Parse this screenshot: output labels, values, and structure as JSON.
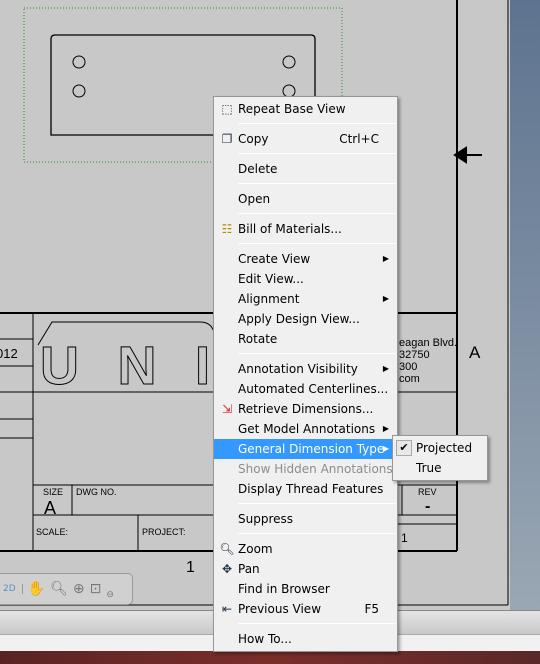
{
  "drawing": {
    "title_block": {
      "year_fragment": "012",
      "logo_text": "UNI",
      "address_lines": [
        "eagan Blvd.",
        "32750",
        "300",
        "com"
      ],
      "zone_letter": "A",
      "size_label": "SIZE",
      "size_value": "A",
      "dwg_no_label": "DWG NO.",
      "rev_label": "REV",
      "rev_value": "-",
      "scale_label": "SCALE:",
      "project_label": "PROJECT:",
      "sheet_value": "1"
    },
    "sheet_number": "1"
  },
  "nav_toolbar": {
    "mode_label": "2D",
    "tools": [
      "pan-icon",
      "zoom-icon",
      "zoom-all-icon",
      "zoom-window-icon"
    ]
  },
  "context_menu": {
    "items": [
      {
        "label": "Repeat Base View",
        "icon": "repeat-base-view-icon"
      },
      {
        "label": "Copy",
        "shortcut": "Ctrl+C",
        "icon": "copy-icon"
      },
      {
        "label": "Delete"
      },
      {
        "label": "Open"
      },
      {
        "label": "Bill of Materials...",
        "icon": "bill-of-materials-icon"
      },
      {
        "label": "Create View",
        "submenu": true
      },
      {
        "label": "Edit View..."
      },
      {
        "label": "Alignment",
        "submenu": true
      },
      {
        "label": "Apply Design View..."
      },
      {
        "label": "Rotate"
      },
      {
        "label": "Annotation Visibility",
        "submenu": true
      },
      {
        "label": "Automated Centerlines..."
      },
      {
        "label": "Retrieve Dimensions...",
        "icon": "retrieve-dimensions-icon"
      },
      {
        "label": "Get Model Annotations",
        "submenu": true
      },
      {
        "label": "General Dimension Type",
        "submenu": true,
        "highlighted": true
      },
      {
        "label": "Show Hidden Annotations",
        "disabled": true
      },
      {
        "label": "Display Thread Features"
      },
      {
        "label": "Suppress"
      },
      {
        "label": "Zoom",
        "icon": "zoom-icon"
      },
      {
        "label": "Pan",
        "icon": "pan-icon"
      },
      {
        "label": "Find in Browser"
      },
      {
        "label": "Previous View",
        "shortcut": "F5",
        "icon": "previous-view-icon"
      },
      {
        "label": "How To..."
      }
    ]
  },
  "submenu": {
    "items": [
      {
        "label": "Projected",
        "checked": true
      },
      {
        "label": "True",
        "checked": false
      }
    ]
  },
  "colors": {
    "highlight": "#3399ff",
    "menu_bg": "#f0f0f0",
    "canvas_bg": "#c8c8c8"
  }
}
